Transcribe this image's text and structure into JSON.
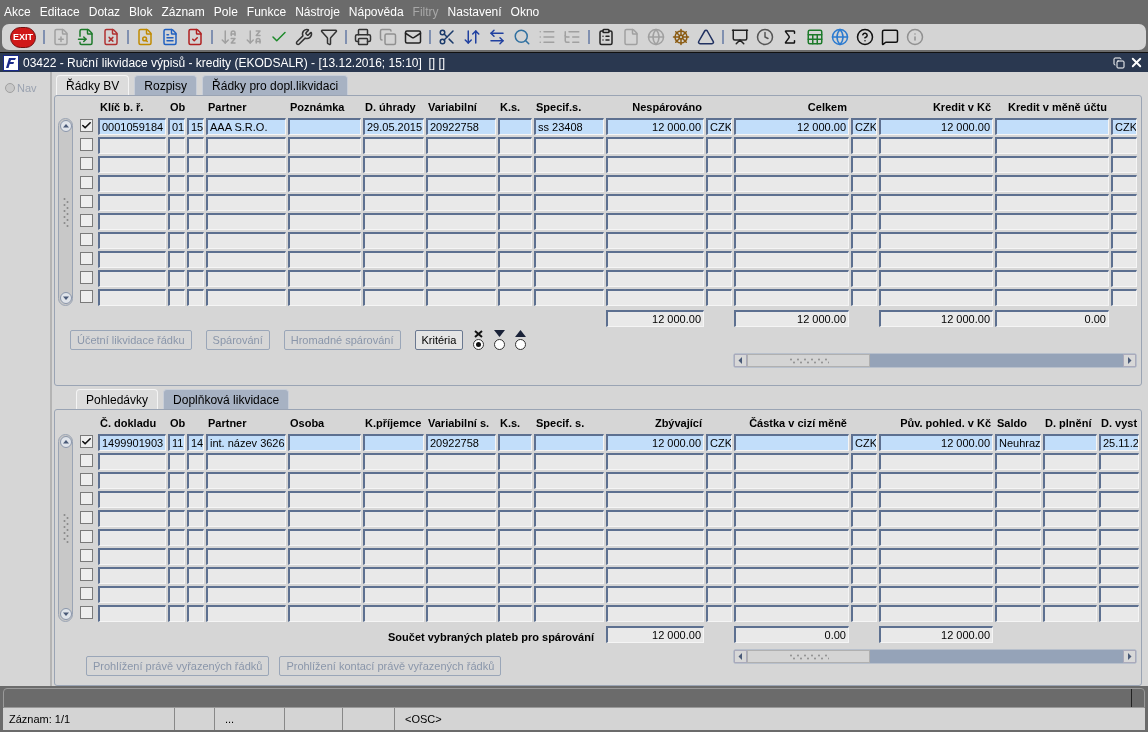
{
  "menu": [
    {
      "label": "Akce",
      "disabled": false
    },
    {
      "label": "Editace",
      "disabled": false
    },
    {
      "label": "Dotaz",
      "disabled": false
    },
    {
      "label": "Blok",
      "disabled": false
    },
    {
      "label": "Záznam",
      "disabled": false
    },
    {
      "label": "Pole",
      "disabled": false
    },
    {
      "label": "Funkce",
      "disabled": false
    },
    {
      "label": "Nástroje",
      "disabled": false
    },
    {
      "label": "Nápověda",
      "disabled": false
    },
    {
      "label": "Filtry",
      "disabled": true
    },
    {
      "label": "Nastavení",
      "disabled": false
    },
    {
      "label": "Okno",
      "disabled": false
    }
  ],
  "toolbar": {
    "exit_label": "EXIT"
  },
  "window": {
    "title": "03422 - Ruční likvidace výpisů - kredity (EKODSALR) - [13.12.2016; 15:10]  [] []"
  },
  "nav": {
    "label": "Nav",
    "selected": false,
    "disabled": true
  },
  "top_tabs": [
    {
      "label": "Řádky BV",
      "selected": true
    },
    {
      "label": "Rozpisy",
      "selected": false
    },
    {
      "label": "Řádky pro dopl.likvidaci",
      "selected": false
    }
  ],
  "top_grid": {
    "columns": [
      {
        "header": "Klíč b. ř.",
        "kind": "text"
      },
      {
        "header": "Ob",
        "kind": "text"
      },
      {
        "kind": "text"
      },
      {
        "header": "Partner",
        "kind": "text"
      },
      {
        "header": "Poznámka",
        "kind": "text"
      },
      {
        "header": "D. úhrady",
        "kind": "text"
      },
      {
        "header": "Variabilní",
        "kind": "text"
      },
      {
        "header": "K.s.",
        "kind": "text"
      },
      {
        "header": "Specif.s.",
        "kind": "text"
      },
      {
        "header": "Nespárováno",
        "kind": "amount",
        "total": "12 000.00"
      },
      {
        "kind": "currency"
      },
      {
        "header": "Celkem",
        "kind": "amount",
        "total": "12 000.00"
      },
      {
        "kind": "currency"
      },
      {
        "header": "Kredit v Kč",
        "kind": "amount",
        "total": "12 000.00"
      },
      {
        "header": "Kredit v měně účtu",
        "kind": "amount",
        "total": "0.00"
      },
      {
        "kind": "currency"
      }
    ],
    "rows": [
      {
        "checked": true,
        "selected": true,
        "cells": [
          "0001059184",
          "01",
          "15",
          "AAA S.R.O.",
          null,
          "29.05.2015",
          "20922758",
          null,
          "ss 23408",
          "12 000.00",
          "CZK",
          "12 000.00",
          "CZK",
          "12 000.00",
          null,
          "CZK"
        ]
      },
      {
        "checked": false,
        "selected": false
      },
      {
        "checked": false,
        "selected": false
      },
      {
        "checked": false,
        "selected": false
      },
      {
        "checked": false,
        "selected": false
      },
      {
        "checked": false,
        "selected": false
      },
      {
        "checked": false,
        "selected": false
      },
      {
        "checked": false,
        "selected": false
      },
      {
        "checked": false,
        "selected": false
      },
      {
        "checked": false,
        "selected": false
      }
    ]
  },
  "top_buttons": [
    {
      "label": "Účetní likvidace řádku",
      "disabled": true
    },
    {
      "label": "Spárování",
      "disabled": true
    },
    {
      "label": "Hromadné spárování",
      "disabled": true
    },
    {
      "label": "Kritéria",
      "disabled": false
    }
  ],
  "sort_options": [
    {
      "kind": "none",
      "selected": true
    },
    {
      "kind": "descending",
      "selected": false
    },
    {
      "kind": "ascending",
      "selected": false
    }
  ],
  "bottom_tabs": [
    {
      "label": "Pohledávky",
      "selected": true
    },
    {
      "label": "Doplňková likvidace",
      "selected": false
    }
  ],
  "bottom_grid": {
    "columns": [
      {
        "header": "Č. dokladu",
        "kind": "text"
      },
      {
        "header": "Ob",
        "kind": "text"
      },
      {
        "kind": "text"
      },
      {
        "header": "Partner",
        "kind": "text"
      },
      {
        "header": "Osoba",
        "kind": "text"
      },
      {
        "header": "K.příjemce",
        "kind": "text"
      },
      {
        "header": "Variabilní s.",
        "kind": "text"
      },
      {
        "header": "K.s.",
        "kind": "text"
      },
      {
        "header": "Specif. s.",
        "kind": "text"
      },
      {
        "header": "Zbývající",
        "kind": "amount",
        "total": "12 000.00"
      },
      {
        "kind": "currency"
      },
      {
        "header": "Částka v cizí měně",
        "kind": "amount",
        "total": "0.00"
      },
      {
        "kind": "currency"
      },
      {
        "header": "Pův. pohled. v Kč",
        "kind": "amount",
        "total": "12 000.00"
      },
      {
        "header": "Saldo",
        "kind": "text"
      },
      {
        "header": "D. plnění",
        "kind": "text"
      },
      {
        "header": "D. vyst",
        "kind": "text"
      }
    ],
    "rows": [
      {
        "checked": true,
        "selected": true,
        "cells": [
          "1499901903",
          "11",
          "14",
          "int. název 3626",
          null,
          null,
          "20922758",
          null,
          null,
          "12 000.00",
          "CZK",
          null,
          "CZK",
          "12 000.00",
          "Neuhraz",
          null,
          "25.11.2"
        ]
      },
      {
        "checked": false,
        "selected": false
      },
      {
        "checked": false,
        "selected": false
      },
      {
        "checked": false,
        "selected": false
      },
      {
        "checked": false,
        "selected": false
      },
      {
        "checked": false,
        "selected": false
      },
      {
        "checked": false,
        "selected": false
      },
      {
        "checked": false,
        "selected": false
      },
      {
        "checked": false,
        "selected": false
      },
      {
        "checked": false,
        "selected": false
      }
    ],
    "totals_label": "Součet vybraných plateb pro spárování"
  },
  "bottom_buttons": [
    {
      "label": "Prohlížení právě vyřazených řádků",
      "disabled": true
    },
    {
      "label": "Prohlížení kontací právě vyřazených řádků",
      "disabled": true
    }
  ],
  "status_bar": {
    "record": "Záznam: 1/1",
    "field_2": "...",
    "mode": "<OSC>"
  }
}
